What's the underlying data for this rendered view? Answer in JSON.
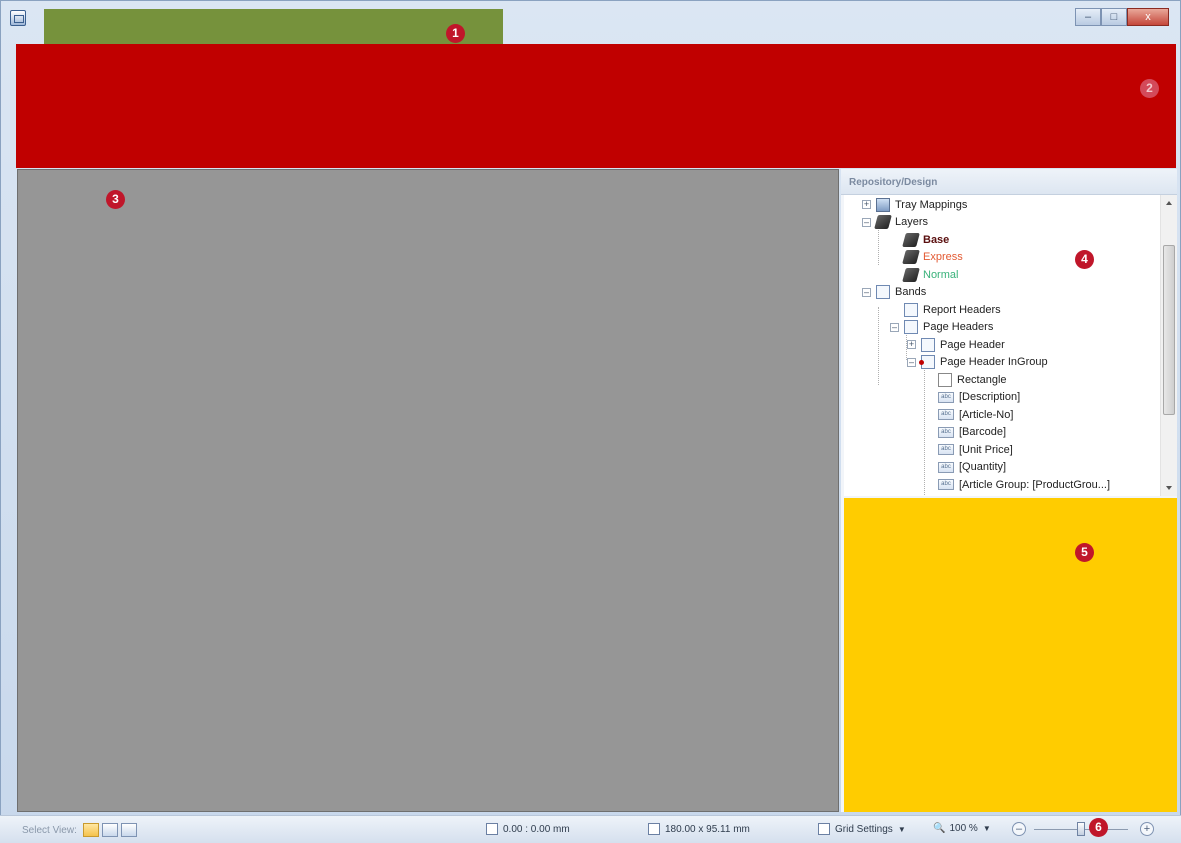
{
  "window": {
    "buttons": {
      "minimize": "–",
      "maximize": "□",
      "close": "x"
    }
  },
  "areas": {
    "quick_access_color": "#76923c",
    "ribbon_color": "#c00000",
    "canvas_color": "#969696",
    "properties_color": "#ffcc00"
  },
  "callouts": [
    "1",
    "2",
    "3",
    "4",
    "5",
    "6"
  ],
  "repository": {
    "title": "Repository/Design",
    "tree": [
      {
        "label": "Tray Mappings",
        "level": 0,
        "toggle": "+",
        "icon": "tray-icon"
      },
      {
        "label": "Layers",
        "level": 0,
        "toggle": "–",
        "icon": "layers-icon"
      },
      {
        "label": "Base",
        "level": 1,
        "icon": "layer-icon",
        "style": "base"
      },
      {
        "label": "Express",
        "level": 1,
        "icon": "layer-icon",
        "style": "express"
      },
      {
        "label": "Normal",
        "level": 1,
        "icon": "layer-icon",
        "style": "normal"
      },
      {
        "label": "Bands",
        "level": 0,
        "toggle": "–",
        "icon": "page-icon"
      },
      {
        "label": "Report Headers",
        "level": 1,
        "icon": "page-icon"
      },
      {
        "label": "Page Headers",
        "level": 1,
        "toggle": "–",
        "icon": "page-icon"
      },
      {
        "label": "Page Header",
        "level": 2,
        "toggle": "+",
        "icon": "page-icon"
      },
      {
        "label": "Page Header InGroup",
        "level": 2,
        "toggle": "–",
        "icon": "page-icon-red"
      },
      {
        "label": "Rectangle",
        "level": 3,
        "icon": "rectangle-icon"
      },
      {
        "label": "[Description]",
        "level": 3,
        "icon": "text-field-icon"
      },
      {
        "label": "[Article-No]",
        "level": 3,
        "icon": "text-field-icon"
      },
      {
        "label": "[Barcode]",
        "level": 3,
        "icon": "text-field-icon"
      },
      {
        "label": "[Unit Price]",
        "level": 3,
        "icon": "text-field-icon"
      },
      {
        "label": "[Quantity]",
        "level": 3,
        "icon": "text-field-icon"
      },
      {
        "label": "[Article Group: [ProductGrou...]",
        "level": 3,
        "icon": "text-field-icon"
      }
    ]
  },
  "statusbar": {
    "select_view_label": "Select View:",
    "position": "0.00 : 0.00 mm",
    "size": "180.00 x 95.11 mm",
    "grid_settings": "Grid Settings",
    "zoom": "100 %"
  }
}
